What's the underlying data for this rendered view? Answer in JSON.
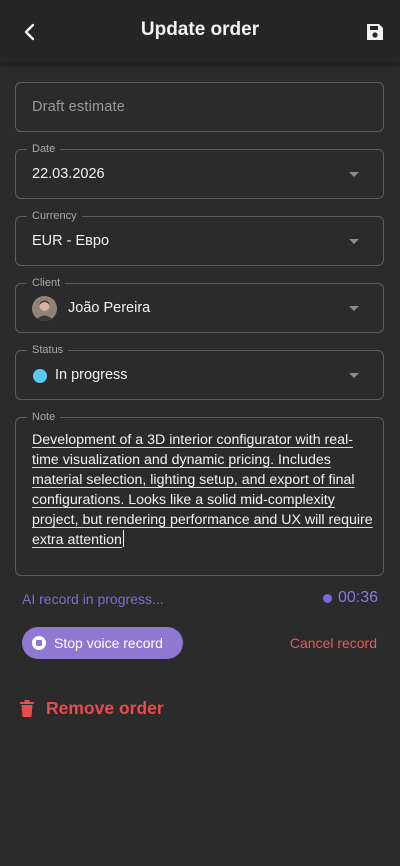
{
  "header": {
    "title": "Update order"
  },
  "form": {
    "name_placeholder": "Draft estimate",
    "date": {
      "label": "Date",
      "value": "22.03.2026"
    },
    "currency": {
      "label": "Currency",
      "value": "EUR - Евро"
    },
    "client": {
      "label": "Client",
      "value": "João Pereira"
    },
    "status": {
      "label": "Status",
      "value": "In progress",
      "color": "#5bc8f5"
    },
    "note": {
      "label": "Note",
      "value": "Development of a 3D interior configurator with real-time visualization and dynamic pricing. Includes material selection, lighting setup, and export of final configurations. Looks like a solid mid-complexity project, but rendering performance and UX will require extra attention"
    }
  },
  "recording": {
    "status_text": "AI record in progress...",
    "timer": "00:36",
    "stop_label": "Stop voice record",
    "cancel_label": "Cancel record"
  },
  "actions": {
    "remove_label": "Remove order"
  },
  "colors": {
    "background": "#2b2b2b",
    "accent": "#8e78d2",
    "danger": "#e84c4c",
    "status": "#5bc8f5"
  },
  "icons": [
    "back-arrow-icon",
    "save-icon",
    "chevron-down-icon",
    "stop-icon",
    "trash-icon"
  ]
}
